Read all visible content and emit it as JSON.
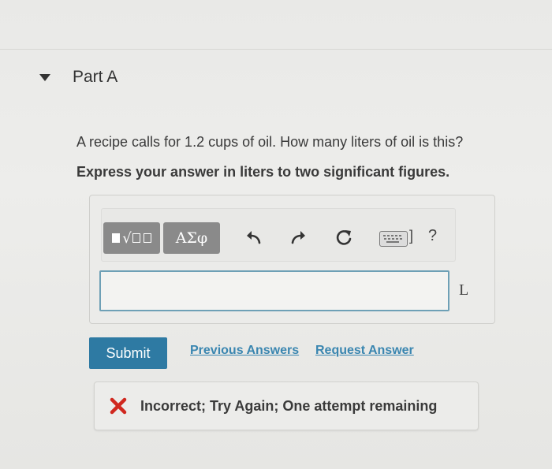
{
  "part": {
    "title": "Part A"
  },
  "question": {
    "text": "A recipe calls for 1.2 cups of oil. How many liters of oil is this?",
    "instruction": "Express your answer in liters to two significant figures."
  },
  "toolbar": {
    "greek_label": "ΑΣφ",
    "keyboard_bracket": "]",
    "help_label": "?",
    "icons": [
      "templates-icon",
      "greek-letters-icon",
      "undo-icon",
      "redo-icon",
      "reset-icon",
      "keyboard-icon",
      "help-icon"
    ]
  },
  "answer": {
    "value": "",
    "unit": "L"
  },
  "actions": {
    "submit_label": "Submit",
    "previous_answers_label": "Previous Answers",
    "request_answer_label": "Request Answer"
  },
  "feedback": {
    "text": "Incorrect; Try Again; One attempt remaining",
    "status_color": "#d0281f"
  },
  "colors": {
    "accent": "#2e7aa3",
    "link": "#3a86b0",
    "input_border": "#6ea0b6"
  }
}
